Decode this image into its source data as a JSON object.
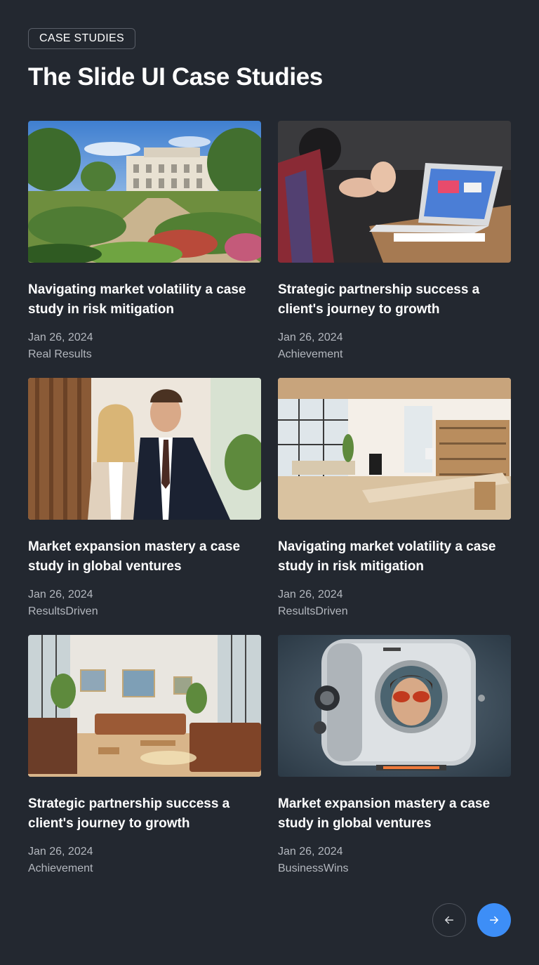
{
  "header": {
    "badge": "CASE STUDIES",
    "title": "The Slide UI Case Studies"
  },
  "cards": [
    {
      "title": "Navigating market volatility a case study in risk mitigation",
      "date": "Jan 26, 2024",
      "tag": "Real Results",
      "image": "garden-estate"
    },
    {
      "title": "Strategic partnership success a client's journey to growth",
      "date": "Jan 26, 2024",
      "tag": "Achievement",
      "image": "laptop-meeting"
    },
    {
      "title": "Market expansion mastery a case study in global ventures",
      "date": "Jan 26, 2024",
      "tag": "ResultsDriven",
      "image": "business-couple"
    },
    {
      "title": "Navigating market volatility a case study in risk mitigation",
      "date": "Jan 26, 2024",
      "tag": "ResultsDriven",
      "image": "open-office"
    },
    {
      "title": "Strategic partnership success a client's journey to growth",
      "date": "Jan 26, 2024",
      "tag": "Achievement",
      "image": "lounge-room"
    },
    {
      "title": "Market expansion mastery a case study in global ventures",
      "date": "Jan 26, 2024",
      "tag": "BusinessWins",
      "image": "retro-robot"
    }
  ],
  "pagination": {
    "prev_icon": "arrow-left-icon",
    "next_icon": "arrow-right-icon"
  },
  "colors": {
    "background": "#232830",
    "accent": "#3d8ef7",
    "muted_text": "#b3b7be"
  }
}
